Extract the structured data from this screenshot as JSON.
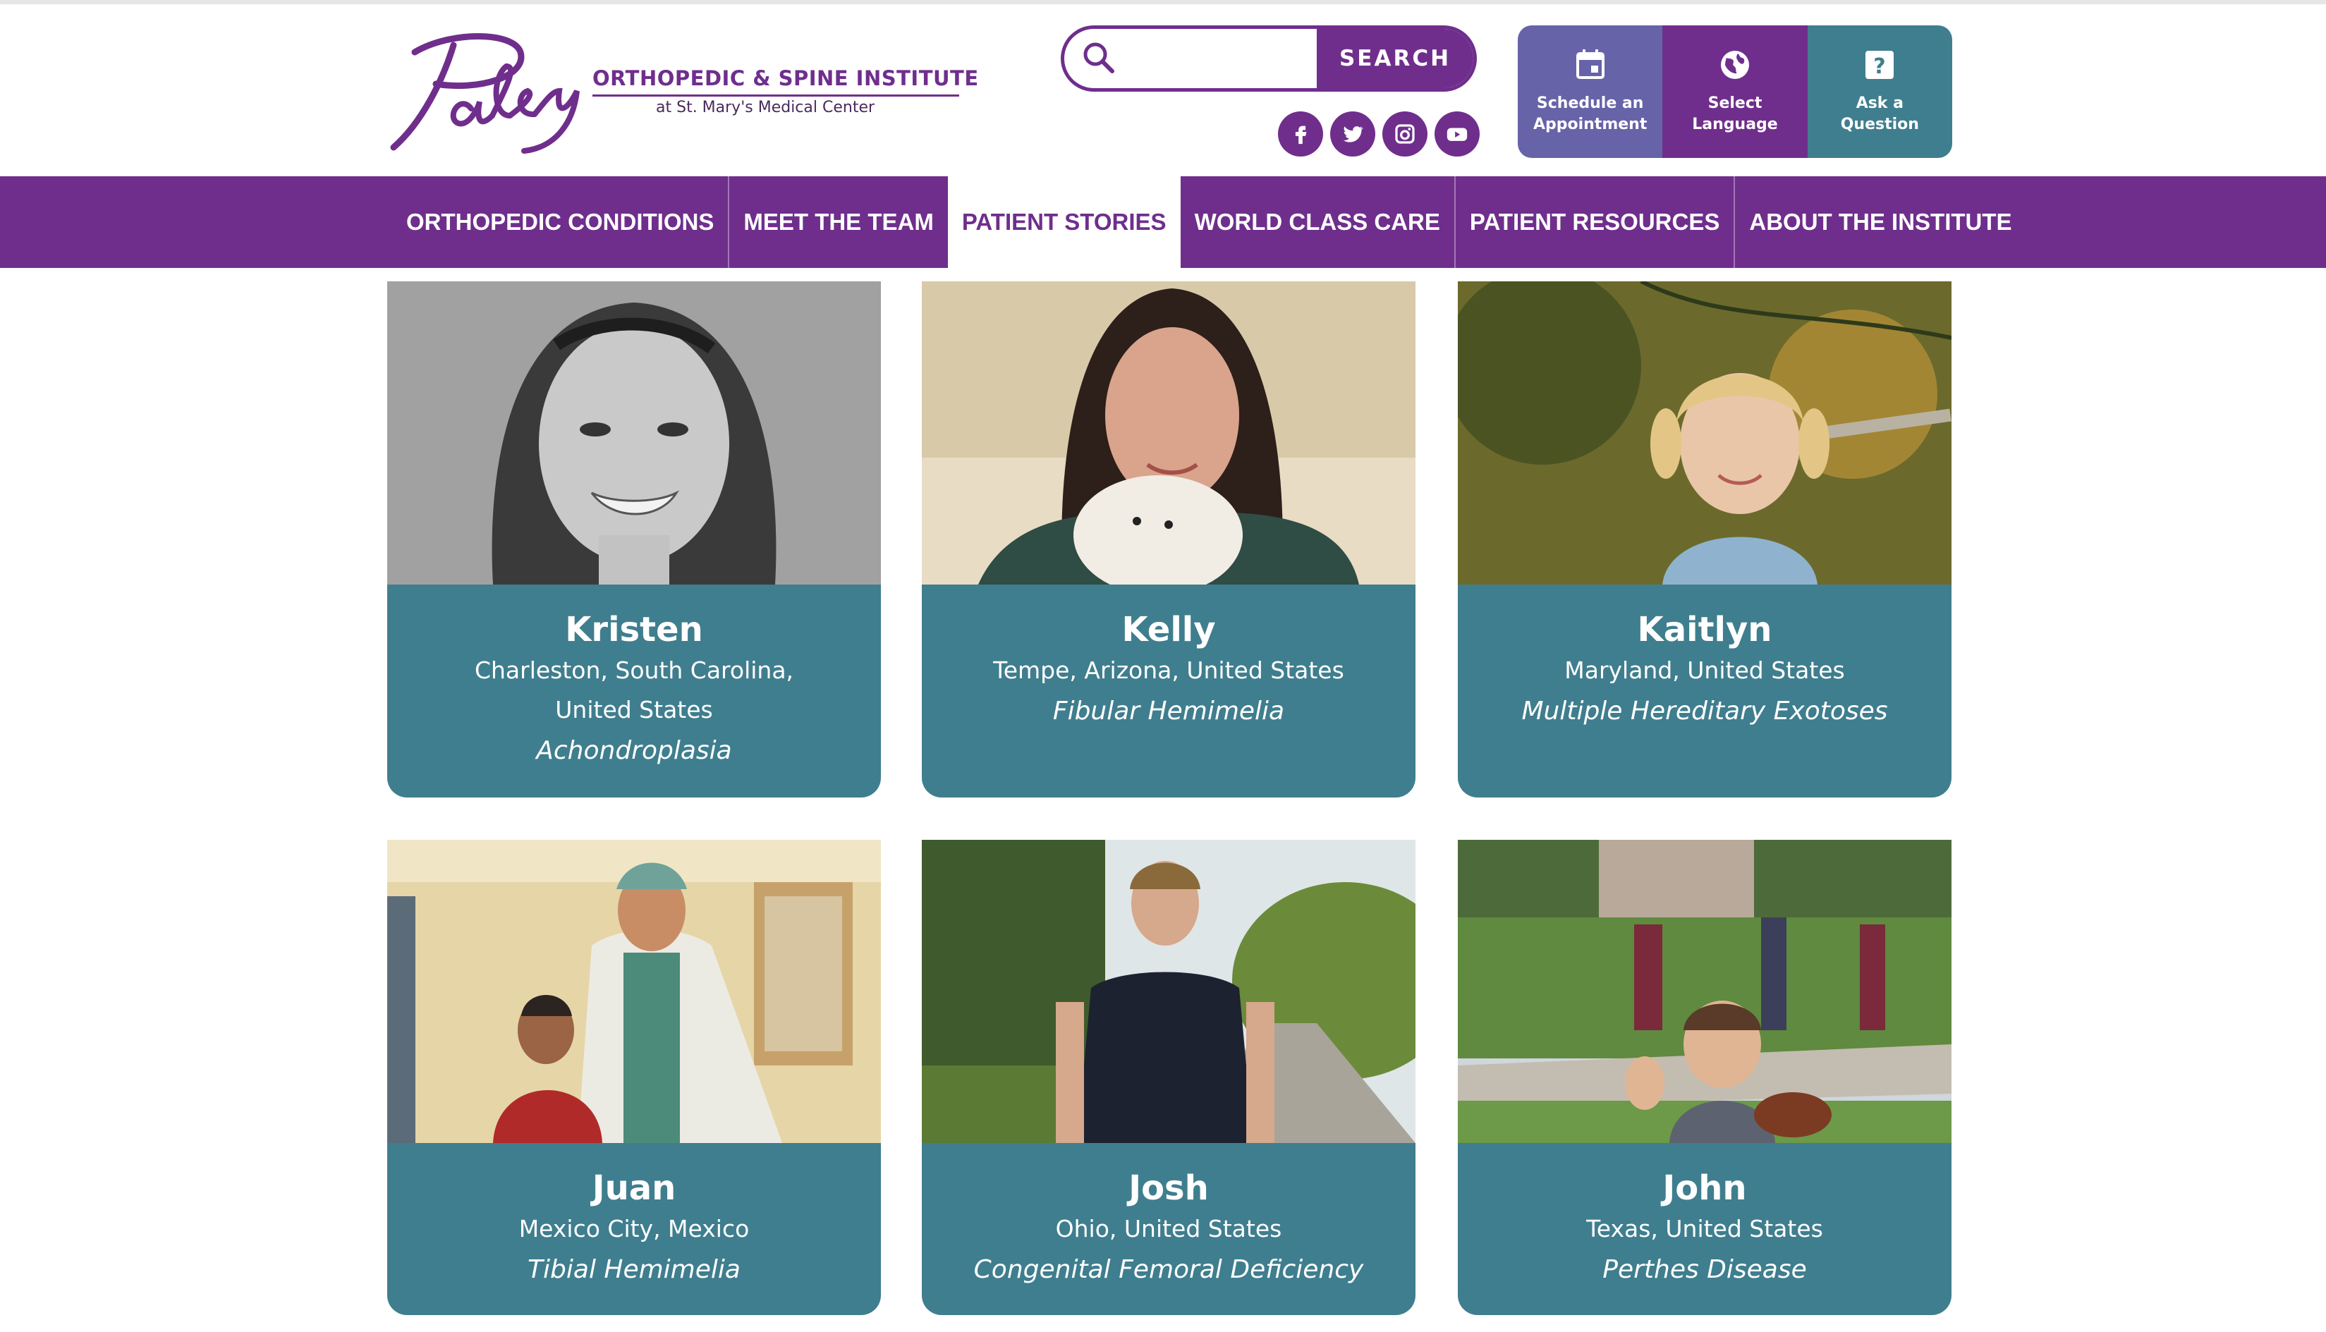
{
  "header": {
    "logo_script": "Paley",
    "logo_title": "ORTHOPEDIC & SPINE INSTITUTE",
    "logo_subtitle": "at St. Mary's Medical Center",
    "search": {
      "placeholder": "",
      "value": "",
      "button_label": "SEARCH"
    },
    "social": [
      {
        "icon": "facebook-icon"
      },
      {
        "icon": "twitter-icon"
      },
      {
        "icon": "instagram-icon"
      },
      {
        "icon": "youtube-icon"
      }
    ],
    "quick_links": [
      {
        "label": "Schedule an Appointment",
        "icon": "calendar-icon",
        "color": "#6763a8"
      },
      {
        "label": "Select Language",
        "icon": "globe-icon",
        "color": "#6f2e8c"
      },
      {
        "label": "Ask a Question",
        "icon": "question-icon",
        "color": "#3f7e8e"
      }
    ]
  },
  "nav": {
    "items": [
      {
        "label": "ORTHOPEDIC CONDITIONS"
      },
      {
        "label": "MEET THE TEAM"
      },
      {
        "label": "PATIENT STORIES",
        "active": true
      },
      {
        "label": "WORLD CLASS CARE"
      },
      {
        "label": "PATIENT RESOURCES"
      },
      {
        "label": "ABOUT THE INSTITUTE"
      }
    ]
  },
  "stories": [
    {
      "name": "Kristen",
      "location": "Charleston, South Carolina, United States",
      "condition": "Achondroplasia"
    },
    {
      "name": "Kelly",
      "location": "Tempe, Arizona, United States",
      "condition": "Fibular Hemimelia"
    },
    {
      "name": "Kaitlyn",
      "location": "Maryland, United States",
      "condition": "Multiple Hereditary Exotoses"
    },
    {
      "name": "Juan",
      "location": "Mexico City, Mexico",
      "condition": "Tibial Hemimelia"
    },
    {
      "name": "Josh",
      "location": "Ohio, United States",
      "condition": "Congenital Femoral Deficiency"
    },
    {
      "name": "John",
      "location": "Texas, United States",
      "condition": "Perthes Disease"
    }
  ],
  "colors": {
    "brand_purple": "#6f2e8c",
    "card_teal": "#3f7e8e"
  }
}
